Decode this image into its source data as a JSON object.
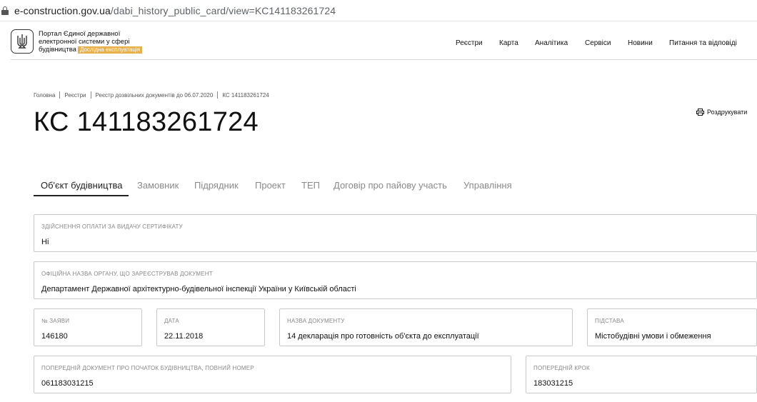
{
  "browser": {
    "url_host": "e-construction.gov.ua",
    "url_path": "/dabi_history_public_card/view=KC141183261724"
  },
  "header": {
    "portal_line1": "Портал Єдиної державної",
    "portal_line2": "електронної системи у сфері",
    "portal_line3": "будівництва",
    "beta_badge": "Дослідна експлуатація",
    "nav": [
      "Реєстри",
      "Карта",
      "Аналітика",
      "Сервіси",
      "Новини",
      "Питання та відповіді"
    ]
  },
  "breadcrumb": [
    "Головна",
    "Реєстри",
    "Реєстр дозвільних документів до 06.07.2020",
    "КС 141183261724"
  ],
  "page": {
    "title": "КС 141183261724",
    "print_label": "Роздрукувати"
  },
  "tabs": [
    "Об'єкт будівництва",
    "Замовник",
    "Підрядник",
    "Проект",
    "ТЕП",
    "Договір про пайову участь",
    "Управління"
  ],
  "fields": {
    "payment": {
      "label": "Здійснення оплати за видачу сертифікату",
      "value": "Ні"
    },
    "authority": {
      "label": "Офіційна назва органу, що зареєстрував документ",
      "value": "Департамент Державної архітектурно-будівельної інспекції України у Київській області"
    },
    "application_no": {
      "label": "№ заяви",
      "value": "146180"
    },
    "date": {
      "label": "Дата",
      "value": "22.11.2018"
    },
    "doc_name": {
      "label": "Назва документу",
      "value": "14 декларація про готовність об'єкта до експлуатації"
    },
    "basis": {
      "label": "Підстава",
      "value": "Містобудівні умови і обмеження"
    },
    "prev_doc": {
      "label": "Попередній документ про початок будівництва, повний номер",
      "value": "061183031215"
    },
    "prev_step": {
      "label": "Попередній крок",
      "value": "183031215"
    }
  }
}
